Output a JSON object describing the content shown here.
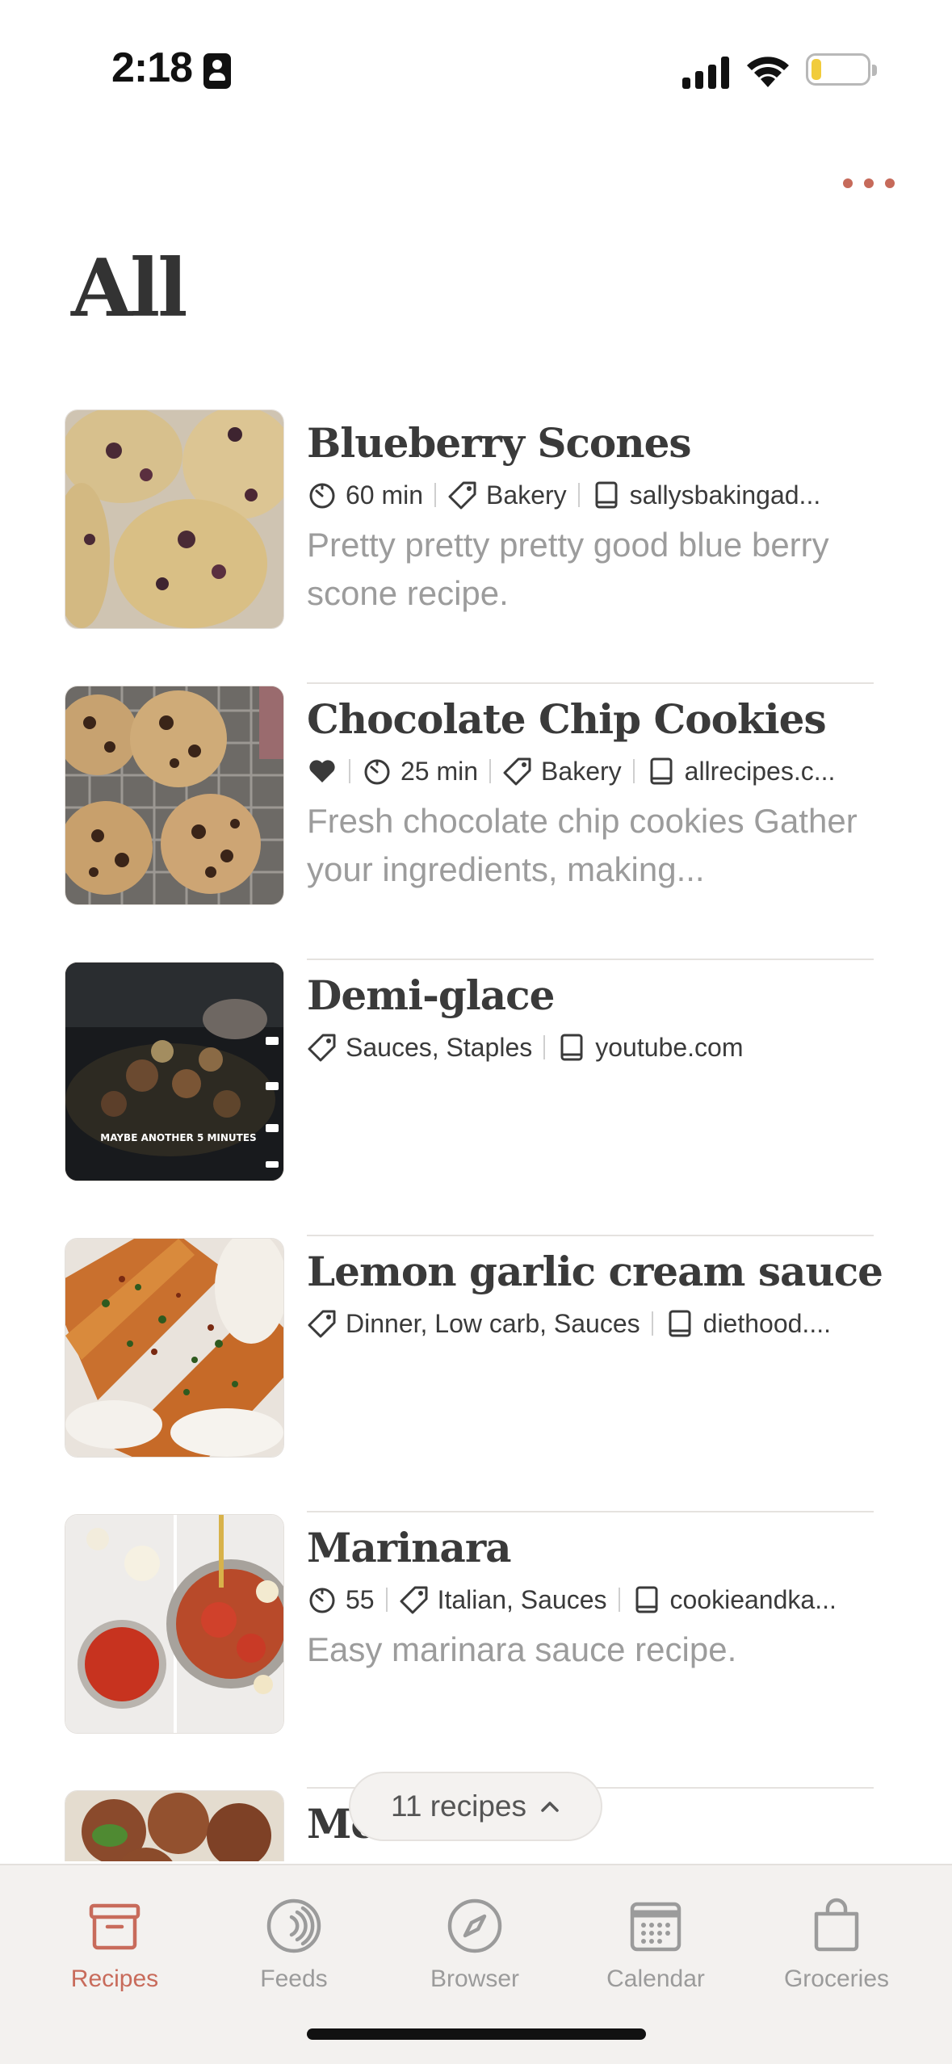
{
  "status_bar": {
    "time": "2:18"
  },
  "page": {
    "title": "All"
  },
  "recipes": [
    {
      "title": "Blueberry Scones",
      "favorite": false,
      "time": "60 min",
      "tags": "Bakery",
      "source": "sallysbakingad...",
      "description": "Pretty pretty pretty good blue berry scone recipe."
    },
    {
      "title": "Chocolate Chip Cookies",
      "favorite": true,
      "time": "25 min",
      "tags": "Bakery",
      "source": "allrecipes.c...",
      "description": "Fresh chocolate chip cookies Gather your ingredients, making..."
    },
    {
      "title": "Demi-glace",
      "favorite": false,
      "time": "",
      "tags": "Sauces, Staples",
      "source": "youtube.com",
      "description": "",
      "thumb_caption": "MAYBE ANOTHER 5 MINUTES"
    },
    {
      "title": "Lemon garlic cream sauce",
      "favorite": false,
      "time": "",
      "tags": "Dinner, Low carb, Sauces",
      "source": "diethood....",
      "description": ""
    },
    {
      "title": "Marinara",
      "favorite": false,
      "time": "55",
      "tags": "Italian, Sauces",
      "source": "cookieandka...",
      "description": "Easy marinara sauce recipe."
    },
    {
      "title": "Meatballs",
      "favorite": false,
      "time": "",
      "tags": "",
      "source": "",
      "description": ""
    }
  ],
  "count_pill": {
    "label": "11 recipes"
  },
  "tabs": [
    {
      "label": "Recipes",
      "icon": "archive-box-icon",
      "active": true
    },
    {
      "label": "Feeds",
      "icon": "feeds-icon",
      "active": false
    },
    {
      "label": "Browser",
      "icon": "compass-icon",
      "active": false
    },
    {
      "label": "Calendar",
      "icon": "calendar-icon",
      "active": false
    },
    {
      "label": "Groceries",
      "icon": "shopping-bag-icon",
      "active": false
    }
  ],
  "colors": {
    "accent": "#c86b5b",
    "muted": "#9b9b9b",
    "tab_bar_bg": "#f3f1ef",
    "battery": "#f1cc3c"
  }
}
